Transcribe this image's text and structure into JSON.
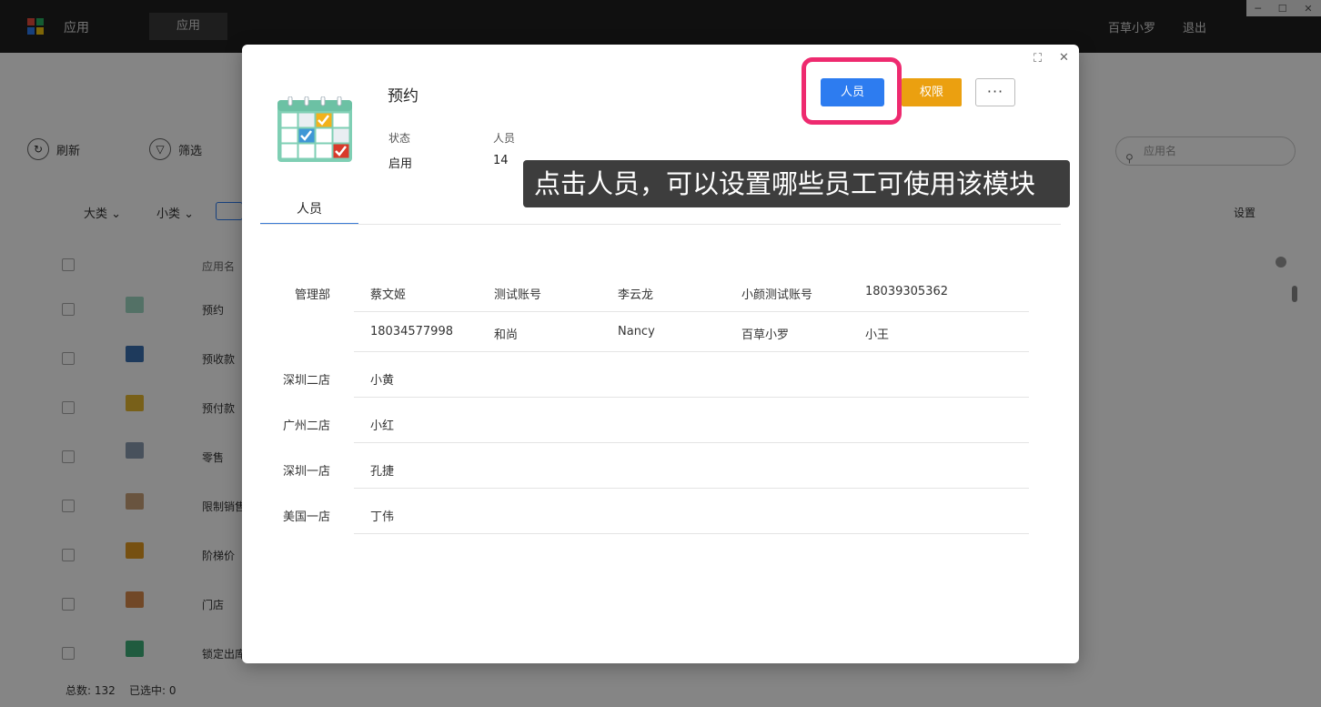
{
  "topbar": {
    "app_title": "应用",
    "tab_label": "应用",
    "user": "百草小罗",
    "logout": "退出",
    "logo_colors": [
      "#e74c3c",
      "#27ae60",
      "#2d7cf0",
      "#f1c40f"
    ]
  },
  "background": {
    "refresh_label": "刷新",
    "filter_label": "筛选",
    "search_placeholder": "应用名",
    "category_major": "大类",
    "category_minor": "小类",
    "settings_label": "设置",
    "column_app_name": "应用名",
    "rows": [
      {
        "name": "预约",
        "icon": "calendar-icon"
      },
      {
        "name": "预收款",
        "icon": "card-icon"
      },
      {
        "name": "预付款",
        "icon": "card-icon"
      },
      {
        "name": "零售",
        "icon": "receipt-icon"
      },
      {
        "name": "限制销售",
        "icon": "person-icon"
      },
      {
        "name": "阶梯价",
        "icon": "bar-chart-icon"
      },
      {
        "name": "门店",
        "icon": "store-icon"
      },
      {
        "name": "锁定出库",
        "icon": "lock-icon"
      }
    ],
    "footer_total_label": "总数:",
    "footer_total": "132",
    "footer_selected_label": "已选中:",
    "footer_selected": "0"
  },
  "modal": {
    "title": "预约",
    "status_label": "状态",
    "status_value": "启用",
    "people_label": "人员",
    "people_value": "14",
    "people_button": "人员",
    "permission_button": "权限",
    "more_button": "···",
    "tooltip": "点击人员，可以设置哪些员工可使用该模块",
    "tab_label": "人员",
    "colors": {
      "primary": "#2d7cf0",
      "warning": "#eba010",
      "highlight": "#ee2a6f"
    },
    "departments": [
      {
        "name": "管理部",
        "rows": [
          [
            "蔡文姬",
            "测试账号",
            "李云龙",
            "小颜测试账号",
            "18039305362"
          ],
          [
            "18034577998",
            "和尚",
            "Nancy",
            "百草小罗",
            "小王"
          ]
        ]
      },
      {
        "name": "深圳二店",
        "rows": [
          [
            "小黄"
          ]
        ]
      },
      {
        "name": "广州二店",
        "rows": [
          [
            "小红"
          ]
        ]
      },
      {
        "name": "深圳一店",
        "rows": [
          [
            "孔捷"
          ]
        ]
      },
      {
        "name": "美国一店",
        "rows": [
          [
            "丁伟"
          ]
        ]
      }
    ]
  }
}
